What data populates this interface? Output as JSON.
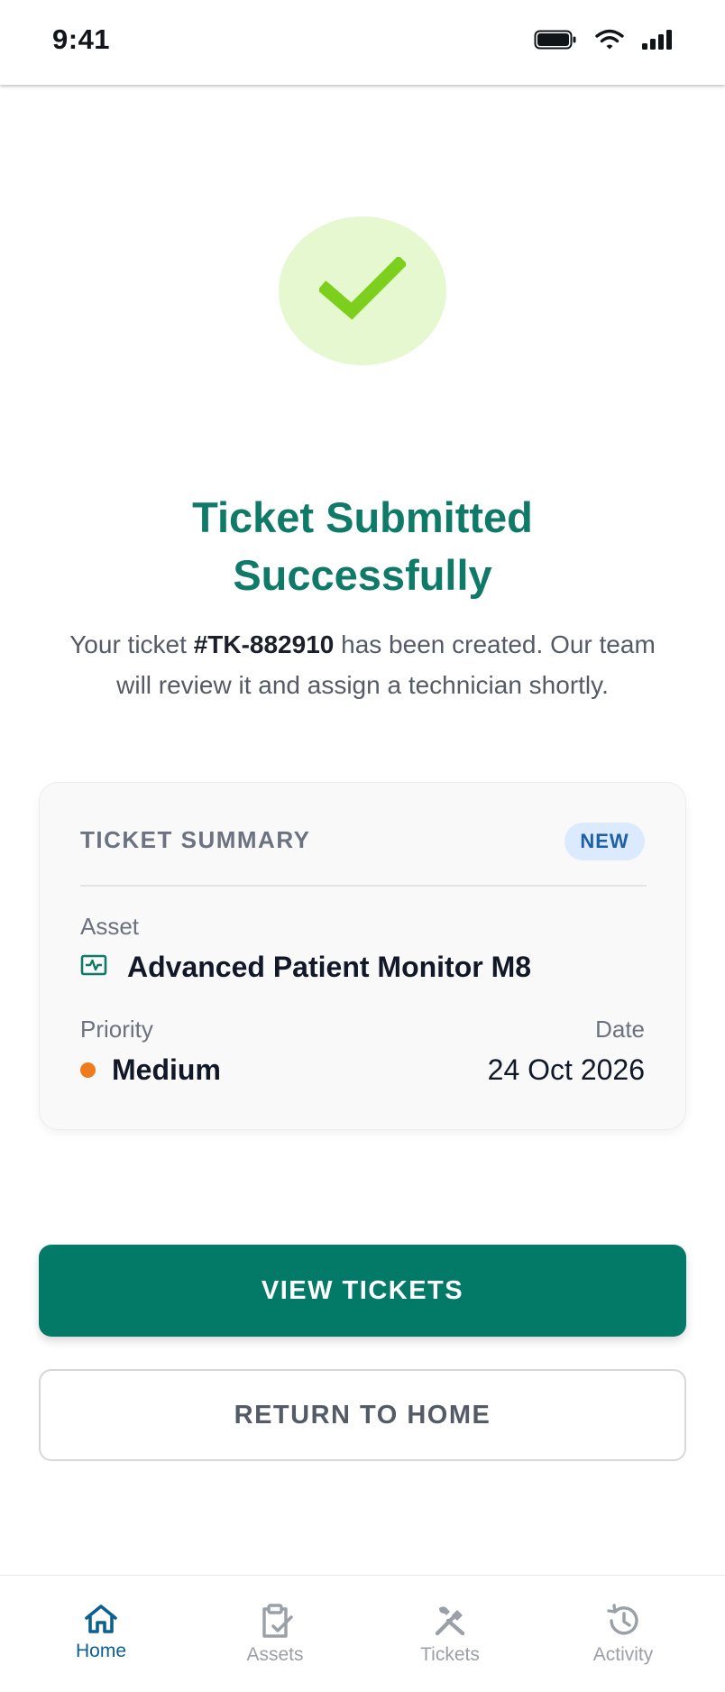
{
  "status_bar": {
    "time": "9:41",
    "icons": [
      "battery-icon",
      "wifi-icon",
      "signal-icon"
    ]
  },
  "success": {
    "icon": "checkmark-icon",
    "color": "#7ccf1c",
    "background": "#e6f8cf"
  },
  "title": {
    "line1": "Ticket Submitted",
    "line2": "Successfully"
  },
  "description": {
    "prefix": "Your ticket ",
    "ticket_id": "#TK-882910",
    "suffix": " has been created. Our team will review it and assign a technician shortly."
  },
  "summary": {
    "heading": "TICKET SUMMARY",
    "badge": "NEW",
    "asset_label": "Asset",
    "asset_icon": "monitor-icon",
    "asset_name": "Advanced Patient Monitor M8",
    "priority_label": "Priority",
    "priority_value": "Medium",
    "priority_color": "#f07a1e",
    "date_label": "Date",
    "date_value": "24 Oct 2026"
  },
  "buttons": {
    "primary": "VIEW TICKETS",
    "secondary": "RETURN TO HOME"
  },
  "nav": {
    "items": [
      {
        "label": "Home",
        "icon": "home-icon",
        "active": true
      },
      {
        "label": "Assets",
        "icon": "clipboard-check-icon",
        "active": false
      },
      {
        "label": "Tickets",
        "icon": "tools-icon",
        "active": false
      },
      {
        "label": "Activity",
        "icon": "history-icon",
        "active": false
      }
    ]
  },
  "colors": {
    "brand": "#0f7a68",
    "button": "#037a68",
    "active_nav": "#0d5f8f"
  }
}
